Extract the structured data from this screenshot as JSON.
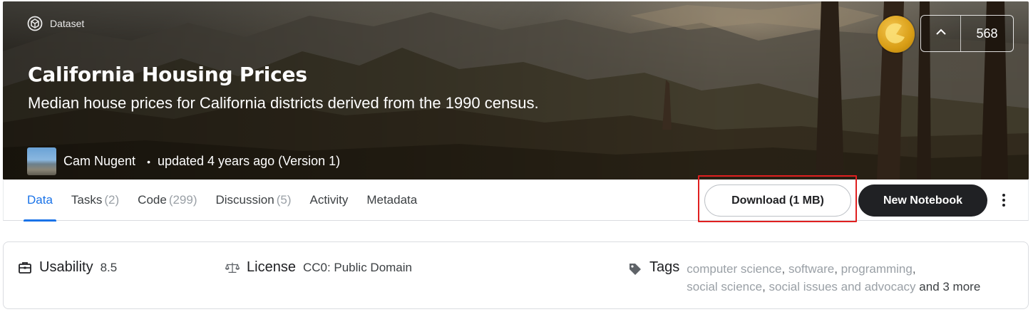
{
  "hero": {
    "chip_label": "Dataset",
    "title": "California Housing Prices",
    "subtitle": "Median house prices for California districts derived from the 1990 census.",
    "author": "Cam Nugent",
    "separator": "•",
    "updated": "updated 4 years ago (Version 1)",
    "vote_count": "568"
  },
  "tabs": [
    {
      "label": "Data",
      "count": ""
    },
    {
      "label": "Tasks",
      "count": "(2)"
    },
    {
      "label": "Code",
      "count": "(299)"
    },
    {
      "label": "Discussion",
      "count": "(5)"
    },
    {
      "label": "Activity",
      "count": ""
    },
    {
      "label": "Metadata",
      "count": ""
    }
  ],
  "actions": {
    "download_label": "Download (1 MB)",
    "new_notebook_label": "New Notebook"
  },
  "info": {
    "usability_label": "Usability",
    "usability_value": "8.5",
    "license_label": "License",
    "license_value": "CC0: Public Domain",
    "tags_label": "Tags",
    "tags": [
      "computer science",
      "software",
      "programming",
      "social science",
      "social issues and advocacy"
    ],
    "tags_more": "and 3 more"
  },
  "icons": {
    "dataset": "dataset-icon",
    "medal": "gold-medal-icon",
    "upvote": "chevron-up-icon",
    "kebab": "more-vert-icon",
    "usability": "usability-icon",
    "license": "scales-icon",
    "tags": "tag-icon"
  },
  "colors": {
    "accent": "#1a73e8",
    "primary_button": "#202124",
    "highlight": "#e02020",
    "medal": "#d99e16",
    "muted_text": "#9aa0a6"
  }
}
